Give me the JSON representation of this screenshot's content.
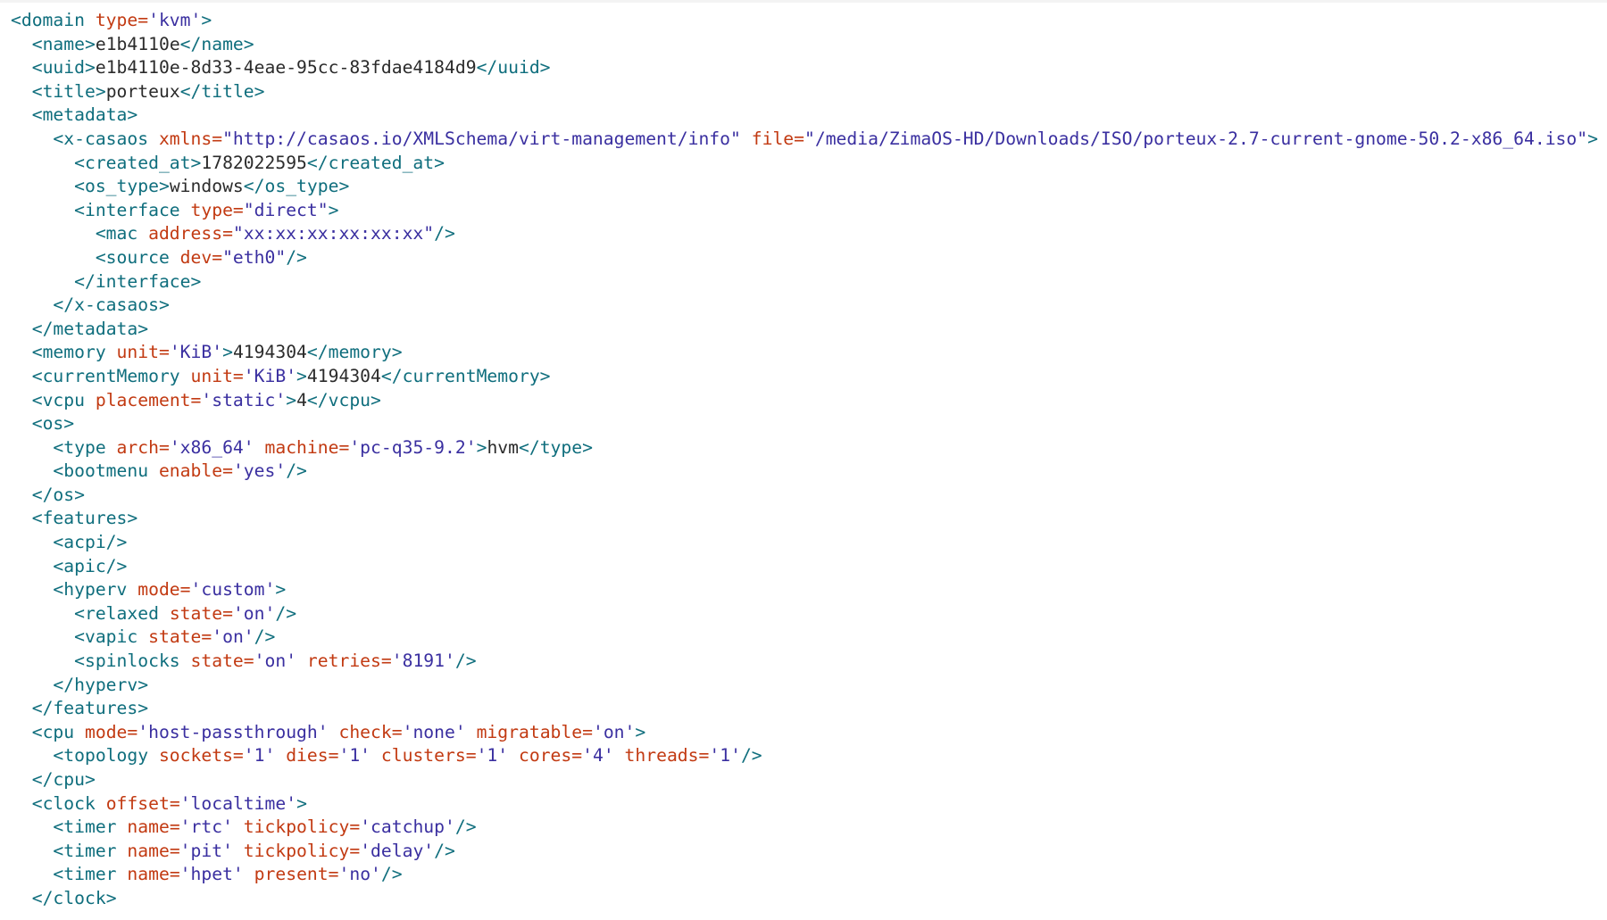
{
  "colors": {
    "tag": "#0f6e7d",
    "attribute": "#c23a12",
    "value": "#3a2fa0",
    "text": "#2b2b2b",
    "background": "#ffffff"
  },
  "lines": [
    {
      "indent": 0,
      "parts": [
        {
          "t": "tag",
          "v": "<domain "
        },
        {
          "t": "attr",
          "v": "type="
        },
        {
          "t": "val",
          "v": "'kvm'"
        },
        {
          "t": "tag",
          "v": ">"
        }
      ]
    },
    {
      "indent": 1,
      "parts": [
        {
          "t": "tag",
          "v": "<name>"
        },
        {
          "t": "txt",
          "v": "e1b4110e"
        },
        {
          "t": "tag",
          "v": "</name>"
        }
      ]
    },
    {
      "indent": 1,
      "parts": [
        {
          "t": "tag",
          "v": "<uuid>"
        },
        {
          "t": "txt",
          "v": "e1b4110e-8d33-4eae-95cc-83fdae4184d9"
        },
        {
          "t": "tag",
          "v": "</uuid>"
        }
      ]
    },
    {
      "indent": 1,
      "parts": [
        {
          "t": "tag",
          "v": "<title>"
        },
        {
          "t": "txt",
          "v": "porteux"
        },
        {
          "t": "tag",
          "v": "</title>"
        }
      ]
    },
    {
      "indent": 1,
      "parts": [
        {
          "t": "tag",
          "v": "<metadata>"
        }
      ]
    },
    {
      "indent": 2,
      "parts": [
        {
          "t": "tag",
          "v": "<x-casaos "
        },
        {
          "t": "attr",
          "v": "xmlns="
        },
        {
          "t": "val",
          "v": "\"http://casaos.io/XMLSchema/virt-management/info\""
        },
        {
          "t": "txt",
          "v": " "
        },
        {
          "t": "attr",
          "v": "file="
        },
        {
          "t": "val",
          "v": "\"/media/ZimaOS-HD/Downloads/ISO/porteux-2.7-current-gnome-50.2-x86_64.iso\""
        },
        {
          "t": "tag",
          "v": ">"
        }
      ]
    },
    {
      "indent": 3,
      "parts": [
        {
          "t": "tag",
          "v": "<created_at>"
        },
        {
          "t": "txt",
          "v": "1782022595"
        },
        {
          "t": "tag",
          "v": "</created_at>"
        }
      ]
    },
    {
      "indent": 3,
      "parts": [
        {
          "t": "tag",
          "v": "<os_type>"
        },
        {
          "t": "txt",
          "v": "windows"
        },
        {
          "t": "tag",
          "v": "</os_type>"
        }
      ]
    },
    {
      "indent": 3,
      "parts": [
        {
          "t": "tag",
          "v": "<interface "
        },
        {
          "t": "attr",
          "v": "type="
        },
        {
          "t": "val",
          "v": "\"direct\""
        },
        {
          "t": "tag",
          "v": ">"
        }
      ]
    },
    {
      "indent": 4,
      "parts": [
        {
          "t": "tag",
          "v": "<mac "
        },
        {
          "t": "attr",
          "v": "address="
        },
        {
          "t": "val",
          "v": "\"xx:xx:xx:xx:xx:xx\""
        },
        {
          "t": "tag",
          "v": "/>"
        }
      ]
    },
    {
      "indent": 4,
      "parts": [
        {
          "t": "tag",
          "v": "<source "
        },
        {
          "t": "attr",
          "v": "dev="
        },
        {
          "t": "val",
          "v": "\"eth0\""
        },
        {
          "t": "tag",
          "v": "/>"
        }
      ]
    },
    {
      "indent": 3,
      "parts": [
        {
          "t": "tag",
          "v": "</interface>"
        }
      ]
    },
    {
      "indent": 2,
      "parts": [
        {
          "t": "tag",
          "v": "</x-casaos>"
        }
      ]
    },
    {
      "indent": 1,
      "parts": [
        {
          "t": "tag",
          "v": "</metadata>"
        }
      ]
    },
    {
      "indent": 1,
      "parts": [
        {
          "t": "tag",
          "v": "<memory "
        },
        {
          "t": "attr",
          "v": "unit="
        },
        {
          "t": "val",
          "v": "'KiB'"
        },
        {
          "t": "tag",
          "v": ">"
        },
        {
          "t": "txt",
          "v": "4194304"
        },
        {
          "t": "tag",
          "v": "</memory>"
        }
      ]
    },
    {
      "indent": 1,
      "parts": [
        {
          "t": "tag",
          "v": "<currentMemory "
        },
        {
          "t": "attr",
          "v": "unit="
        },
        {
          "t": "val",
          "v": "'KiB'"
        },
        {
          "t": "tag",
          "v": ">"
        },
        {
          "t": "txt",
          "v": "4194304"
        },
        {
          "t": "tag",
          "v": "</currentMemory>"
        }
      ]
    },
    {
      "indent": 1,
      "parts": [
        {
          "t": "tag",
          "v": "<vcpu "
        },
        {
          "t": "attr",
          "v": "placement="
        },
        {
          "t": "val",
          "v": "'static'"
        },
        {
          "t": "tag",
          "v": ">"
        },
        {
          "t": "txt",
          "v": "4"
        },
        {
          "t": "tag",
          "v": "</vcpu>"
        }
      ]
    },
    {
      "indent": 1,
      "parts": [
        {
          "t": "tag",
          "v": "<os>"
        }
      ]
    },
    {
      "indent": 2,
      "parts": [
        {
          "t": "tag",
          "v": "<type "
        },
        {
          "t": "attr",
          "v": "arch="
        },
        {
          "t": "val",
          "v": "'x86_64'"
        },
        {
          "t": "txt",
          "v": " "
        },
        {
          "t": "attr",
          "v": "machine="
        },
        {
          "t": "val",
          "v": "'pc-q35-9.2'"
        },
        {
          "t": "tag",
          "v": ">"
        },
        {
          "t": "txt",
          "v": "hvm"
        },
        {
          "t": "tag",
          "v": "</type>"
        }
      ]
    },
    {
      "indent": 2,
      "parts": [
        {
          "t": "tag",
          "v": "<bootmenu "
        },
        {
          "t": "attr",
          "v": "enable="
        },
        {
          "t": "val",
          "v": "'yes'"
        },
        {
          "t": "tag",
          "v": "/>"
        }
      ]
    },
    {
      "indent": 1,
      "parts": [
        {
          "t": "tag",
          "v": "</os>"
        }
      ]
    },
    {
      "indent": 1,
      "parts": [
        {
          "t": "tag",
          "v": "<features>"
        }
      ]
    },
    {
      "indent": 2,
      "parts": [
        {
          "t": "tag",
          "v": "<acpi/>"
        }
      ]
    },
    {
      "indent": 2,
      "parts": [
        {
          "t": "tag",
          "v": "<apic/>"
        }
      ]
    },
    {
      "indent": 2,
      "parts": [
        {
          "t": "tag",
          "v": "<hyperv "
        },
        {
          "t": "attr",
          "v": "mode="
        },
        {
          "t": "val",
          "v": "'custom'"
        },
        {
          "t": "tag",
          "v": ">"
        }
      ]
    },
    {
      "indent": 3,
      "parts": [
        {
          "t": "tag",
          "v": "<relaxed "
        },
        {
          "t": "attr",
          "v": "state="
        },
        {
          "t": "val",
          "v": "'on'"
        },
        {
          "t": "tag",
          "v": "/>"
        }
      ]
    },
    {
      "indent": 3,
      "parts": [
        {
          "t": "tag",
          "v": "<vapic "
        },
        {
          "t": "attr",
          "v": "state="
        },
        {
          "t": "val",
          "v": "'on'"
        },
        {
          "t": "tag",
          "v": "/>"
        }
      ]
    },
    {
      "indent": 3,
      "parts": [
        {
          "t": "tag",
          "v": "<spinlocks "
        },
        {
          "t": "attr",
          "v": "state="
        },
        {
          "t": "val",
          "v": "'on'"
        },
        {
          "t": "txt",
          "v": " "
        },
        {
          "t": "attr",
          "v": "retries="
        },
        {
          "t": "val",
          "v": "'8191'"
        },
        {
          "t": "tag",
          "v": "/>"
        }
      ]
    },
    {
      "indent": 2,
      "parts": [
        {
          "t": "tag",
          "v": "</hyperv>"
        }
      ]
    },
    {
      "indent": 1,
      "parts": [
        {
          "t": "tag",
          "v": "</features>"
        }
      ]
    },
    {
      "indent": 1,
      "parts": [
        {
          "t": "tag",
          "v": "<cpu "
        },
        {
          "t": "attr",
          "v": "mode="
        },
        {
          "t": "val",
          "v": "'host-passthrough'"
        },
        {
          "t": "txt",
          "v": " "
        },
        {
          "t": "attr",
          "v": "check="
        },
        {
          "t": "val",
          "v": "'none'"
        },
        {
          "t": "txt",
          "v": " "
        },
        {
          "t": "attr",
          "v": "migratable="
        },
        {
          "t": "val",
          "v": "'on'"
        },
        {
          "t": "tag",
          "v": ">"
        }
      ]
    },
    {
      "indent": 2,
      "parts": [
        {
          "t": "tag",
          "v": "<topology "
        },
        {
          "t": "attr",
          "v": "sockets="
        },
        {
          "t": "val",
          "v": "'1'"
        },
        {
          "t": "txt",
          "v": " "
        },
        {
          "t": "attr",
          "v": "dies="
        },
        {
          "t": "val",
          "v": "'1'"
        },
        {
          "t": "txt",
          "v": " "
        },
        {
          "t": "attr",
          "v": "clusters="
        },
        {
          "t": "val",
          "v": "'1'"
        },
        {
          "t": "txt",
          "v": " "
        },
        {
          "t": "attr",
          "v": "cores="
        },
        {
          "t": "val",
          "v": "'4'"
        },
        {
          "t": "txt",
          "v": " "
        },
        {
          "t": "attr",
          "v": "threads="
        },
        {
          "t": "val",
          "v": "'1'"
        },
        {
          "t": "tag",
          "v": "/>"
        }
      ]
    },
    {
      "indent": 1,
      "parts": [
        {
          "t": "tag",
          "v": "</cpu>"
        }
      ]
    },
    {
      "indent": 1,
      "parts": [
        {
          "t": "tag",
          "v": "<clock "
        },
        {
          "t": "attr",
          "v": "offset="
        },
        {
          "t": "val",
          "v": "'localtime'"
        },
        {
          "t": "tag",
          "v": ">"
        }
      ]
    },
    {
      "indent": 2,
      "parts": [
        {
          "t": "tag",
          "v": "<timer "
        },
        {
          "t": "attr",
          "v": "name="
        },
        {
          "t": "val",
          "v": "'rtc'"
        },
        {
          "t": "txt",
          "v": " "
        },
        {
          "t": "attr",
          "v": "tickpolicy="
        },
        {
          "t": "val",
          "v": "'catchup'"
        },
        {
          "t": "tag",
          "v": "/>"
        }
      ]
    },
    {
      "indent": 2,
      "parts": [
        {
          "t": "tag",
          "v": "<timer "
        },
        {
          "t": "attr",
          "v": "name="
        },
        {
          "t": "val",
          "v": "'pit'"
        },
        {
          "t": "txt",
          "v": " "
        },
        {
          "t": "attr",
          "v": "tickpolicy="
        },
        {
          "t": "val",
          "v": "'delay'"
        },
        {
          "t": "tag",
          "v": "/>"
        }
      ]
    },
    {
      "indent": 2,
      "parts": [
        {
          "t": "tag",
          "v": "<timer "
        },
        {
          "t": "attr",
          "v": "name="
        },
        {
          "t": "val",
          "v": "'hpet'"
        },
        {
          "t": "txt",
          "v": " "
        },
        {
          "t": "attr",
          "v": "present="
        },
        {
          "t": "val",
          "v": "'no'"
        },
        {
          "t": "tag",
          "v": "/>"
        }
      ]
    },
    {
      "indent": 1,
      "parts": [
        {
          "t": "tag",
          "v": "</clock>"
        }
      ]
    }
  ]
}
